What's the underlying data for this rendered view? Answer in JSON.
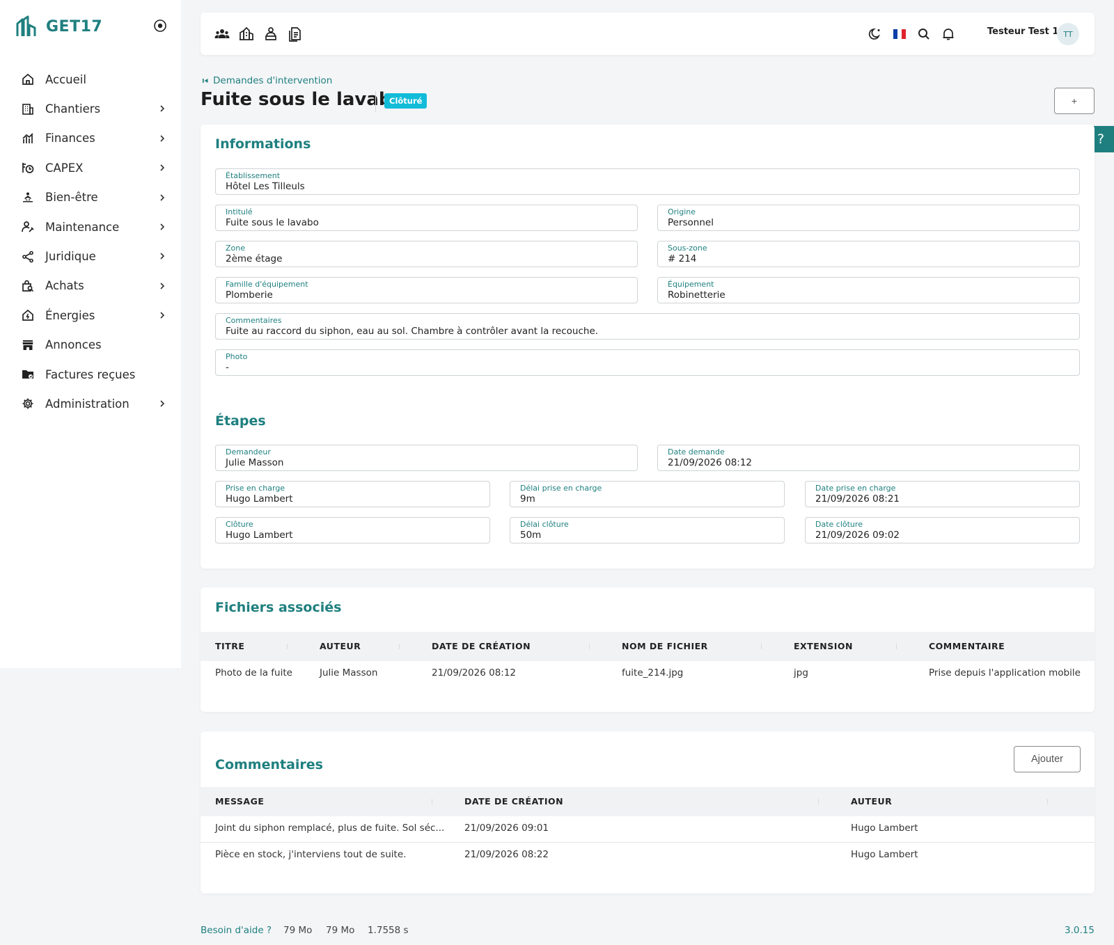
{
  "brand": {
    "name": "GET17"
  },
  "sidebar": {
    "items": [
      {
        "label": "Accueil",
        "icon": "home-icon",
        "has_children": false
      },
      {
        "label": "Chantiers",
        "icon": "building-icon",
        "has_children": true
      },
      {
        "label": "Finances",
        "icon": "finance-chart-icon",
        "has_children": true
      },
      {
        "label": "CAPEX",
        "icon": "capex-icon",
        "has_children": true
      },
      {
        "label": "Bien-être",
        "icon": "wellness-icon",
        "has_children": true
      },
      {
        "label": "Maintenance",
        "icon": "maintenance-icon",
        "has_children": true
      },
      {
        "label": "Juridique",
        "icon": "share-icon",
        "has_children": true
      },
      {
        "label": "Achats",
        "icon": "shopping-bag-icon",
        "has_children": true
      },
      {
        "label": "Énergies",
        "icon": "energy-home-icon",
        "has_children": true
      },
      {
        "label": "Annonces",
        "icon": "store-icon",
        "has_children": false
      },
      {
        "label": "Factures reçues",
        "icon": "folder-icon",
        "has_children": false
      },
      {
        "label": "Administration",
        "icon": "gear-icon",
        "has_children": true
      }
    ]
  },
  "header": {
    "user_name": "Testeur Test 1",
    "user_initials": "TT",
    "left_icons": [
      "users-icon",
      "buildings-icon",
      "person-desk-icon",
      "documents-icon"
    ],
    "right_icons": [
      "dark-mode-icon",
      "french-flag-icon",
      "search-icon",
      "bell-icon"
    ]
  },
  "page": {
    "breadcrumb": "Demandes d'intervention",
    "title": "Fuite sous le lavabo",
    "status": "Clôturé",
    "plus_label": "+",
    "help_label": "?"
  },
  "informations": {
    "title": "Informations",
    "etablissement": {
      "label": "Établissement",
      "value": "Hôtel Les Tilleuls"
    },
    "intitule": {
      "label": "Intitulé",
      "value": "Fuite sous le lavabo"
    },
    "origine": {
      "label": "Origine",
      "value": "Personnel"
    },
    "zone": {
      "label": "Zone",
      "value": "2ème étage"
    },
    "sous_zone": {
      "label": "Sous-zone",
      "value": "# 214"
    },
    "famille": {
      "label": "Famille d'équipement",
      "value": "Plomberie"
    },
    "equipement": {
      "label": "Équipement",
      "value": "Robinetterie"
    },
    "commentaires": {
      "label": "Commentaires",
      "value": "Fuite au raccord du siphon, eau au sol. Chambre à contrôler avant la recouche."
    },
    "photo": {
      "label": "Photo",
      "value": "-"
    }
  },
  "etapes": {
    "title": "Étapes",
    "demandeur": {
      "label": "Demandeur",
      "value": "Julie Masson"
    },
    "date_demande": {
      "label": "Date demande",
      "value": "21/09/2026 08:12"
    },
    "prise_en_charge": {
      "label": "Prise en charge",
      "value": "Hugo Lambert"
    },
    "delai_prise": {
      "label": "Délai prise en charge",
      "value": "9m"
    },
    "date_prise": {
      "label": "Date prise en charge",
      "value": "21/09/2026 08:21"
    },
    "cloture": {
      "label": "Clôture",
      "value": "Hugo Lambert"
    },
    "delai_cloture": {
      "label": "Délai clôture",
      "value": "50m"
    },
    "date_cloture": {
      "label": "Date clôture",
      "value": "21/09/2026 09:02"
    }
  },
  "fichiers": {
    "title": "Fichiers associés",
    "columns": [
      "TITRE",
      "AUTEUR",
      "DATE DE CRÉATION",
      "NOM DE FICHIER",
      "EXTENSION",
      "COMMENTAIRE"
    ],
    "rows": [
      [
        "Photo de la fuite",
        "Julie Masson",
        "21/09/2026 08:12",
        "fuite_214.jpg",
        "jpg",
        "Prise depuis l'application mobile"
      ]
    ]
  },
  "commentaires": {
    "title": "Commentaires",
    "add_label": "Ajouter",
    "columns": [
      "MESSAGE",
      "DATE DE CRÉATION",
      "AUTEUR"
    ],
    "rows": [
      [
        "Joint du siphon remplacé, plus de fuite. Sol séc...",
        "21/09/2026 09:01",
        "Hugo Lambert"
      ],
      [
        "Pièce en stock, j'interviens tout de suite.",
        "21/09/2026 08:22",
        "Hugo Lambert"
      ]
    ]
  },
  "footer": {
    "help": "Besoin d'aide ?",
    "mem1": "79 Mo",
    "mem2": "79 Mo",
    "time": "1.7558 s",
    "version": "3.0.15"
  },
  "colors": {
    "accent": "#1f7f7f",
    "badge": "#12bcd8"
  }
}
